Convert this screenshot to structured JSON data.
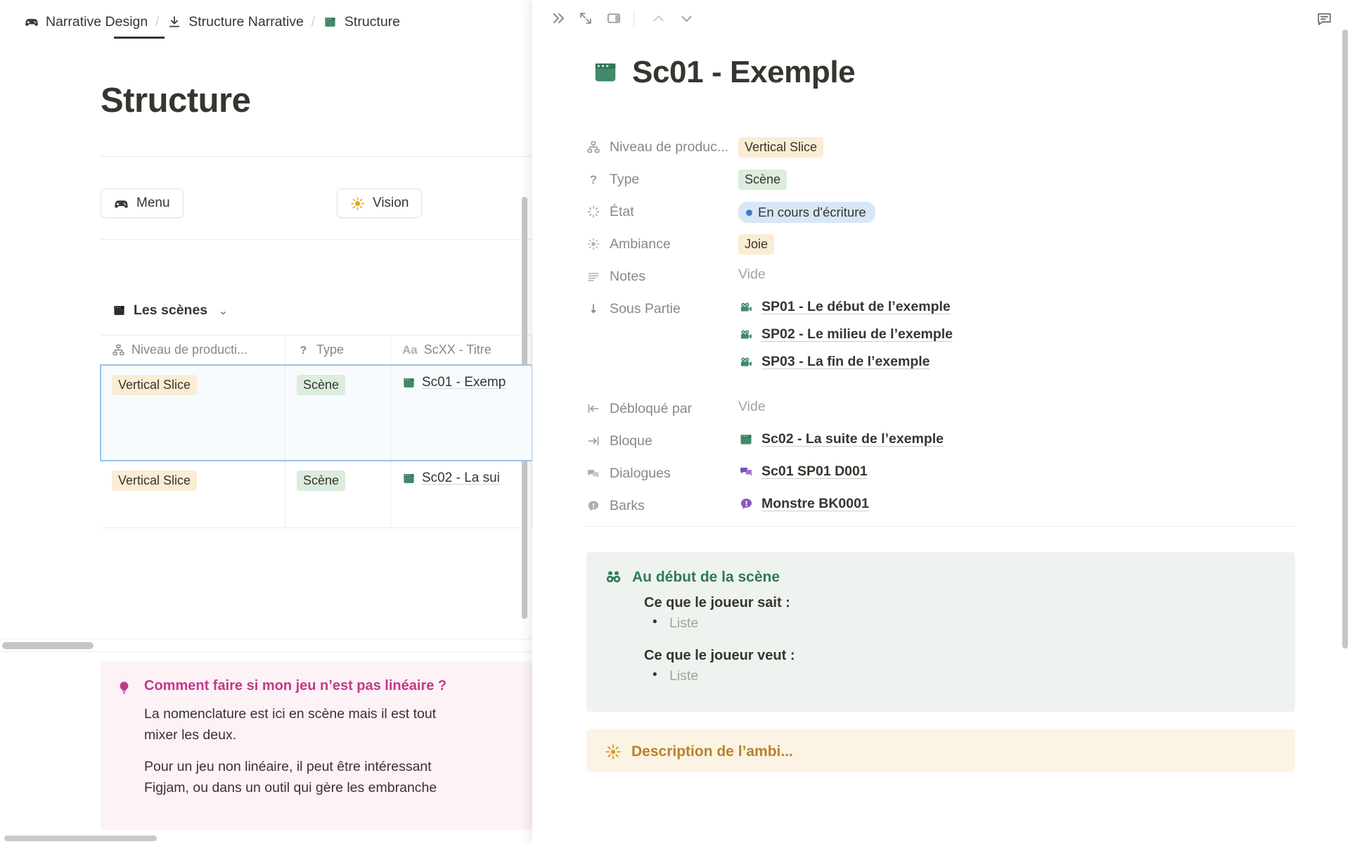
{
  "breadcrumb": {
    "items": [
      {
        "icon": "gamepad-icon",
        "label": "Narrative Design"
      },
      {
        "icon": "download-icon",
        "label": "Structure Narrative"
      },
      {
        "icon": "clapperboard-icon",
        "label": "Structure"
      }
    ],
    "separator": "/"
  },
  "left_page": {
    "title": "Structure",
    "buttons": [
      {
        "icon": "gamepad-icon",
        "label": "Menu"
      },
      {
        "icon": "sun-icon",
        "label": "Vision"
      }
    ],
    "database": {
      "name": "Les scènes",
      "chevron": "⌄",
      "columns": [
        {
          "icon": "hierarchy-icon",
          "label": "Niveau de producti..."
        },
        {
          "icon": "question-icon",
          "label": "Type"
        },
        {
          "icon": "text-icon",
          "prefix": "Aa",
          "label": "ScXX - Titre"
        }
      ],
      "rows": [
        {
          "selected": true,
          "niveau": "Vertical Slice",
          "type": "Scène",
          "titre": "Sc01 - Exemp"
        },
        {
          "selected": false,
          "niveau": "Vertical Slice",
          "type": "Scène",
          "titre": "Sc02 - La sui"
        }
      ]
    },
    "callout_pink": {
      "icon": "lightbulb-icon",
      "title": "Comment faire si mon jeu n’est pas linéaire ?",
      "paragraphs": [
        "La nomenclature est ici en scène mais il est tout",
        "mixer les deux.",
        "Pour un jeu non linéaire, il peut être intéressant",
        "Figjam, ou dans un outil qui gère les embranche"
      ]
    }
  },
  "peek": {
    "toolbar": {
      "collapse": "»",
      "expand": "expand-icon",
      "side_peek": "side-peek-icon",
      "prev": "chevron-up-icon",
      "next": "chevron-down-icon",
      "comments": "comment-icon"
    },
    "doc": {
      "icon": "clapperboard-icon",
      "title": "Sc01 - Exemple"
    },
    "properties": [
      {
        "icon": "hierarchy-icon",
        "label": "Niveau de produc...",
        "kind": "pill-orange",
        "value": "Vertical Slice"
      },
      {
        "icon": "question-icon",
        "label": "Type",
        "kind": "pill-green",
        "value": "Scène"
      },
      {
        "icon": "spinner-icon",
        "label": "État",
        "kind": "status",
        "value": "En cours d'écriture"
      },
      {
        "icon": "sun-icon",
        "label": "Ambiance",
        "kind": "pill-orange",
        "value": "Joie"
      },
      {
        "icon": "lines-icon",
        "label": "Notes",
        "kind": "empty",
        "value": "Vide"
      },
      {
        "icon": "arrow-down-icon",
        "label": "Sous Partie",
        "kind": "relations",
        "relations": [
          {
            "icon": "movie-camera-icon",
            "label": "SP01 - Le début de l’exemple"
          },
          {
            "icon": "movie-camera-icon",
            "label": "SP02 - Le milieu de l’exemple"
          },
          {
            "icon": "movie-camera-icon",
            "label": "SP03 - La fin de l’exemple"
          }
        ]
      },
      {
        "icon": "arrow-to-left-icon",
        "label": "Débloqué par",
        "kind": "empty",
        "value": "Vide"
      },
      {
        "icon": "arrow-to-right-icon",
        "label": "Bloque",
        "kind": "relations",
        "relations": [
          {
            "icon": "clapperboard-icon",
            "label": "Sc02 - La suite de l’exemple"
          }
        ]
      },
      {
        "icon": "speech-bubbles-icon",
        "label": "Dialogues",
        "kind": "relations",
        "relations": [
          {
            "icon": "speech-bubbles-purple-icon",
            "label": "Sc01 SP01 D001"
          }
        ]
      },
      {
        "icon": "bark-bubble-icon",
        "label": "Barks",
        "kind": "relations",
        "relations": [
          {
            "icon": "bark-bubble-purple-icon",
            "label": "Monstre BK0001"
          }
        ]
      }
    ],
    "callout_green": {
      "icon": "binoculars-icon",
      "title": "Au début de la scène",
      "blocks": [
        {
          "heading": "Ce que le joueur sait :",
          "items": [
            "Liste"
          ]
        },
        {
          "heading": "Ce que le joueur veut :",
          "items": [
            "Liste"
          ]
        }
      ]
    },
    "callout_yellow": {
      "icon": "sparkle-icon",
      "title": "Description de l’ambi..."
    }
  },
  "colors": {
    "accent_green": "#2f7a55",
    "accent_pink": "#c2398b",
    "accent_yellow": "#b5842a",
    "status_blue": "#3b7fc4",
    "selection_border": "#94c4f0"
  }
}
